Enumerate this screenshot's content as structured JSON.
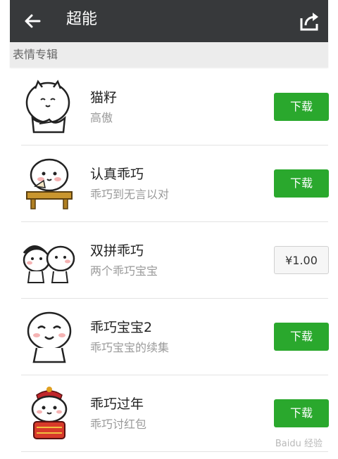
{
  "header": {
    "title": "超能",
    "back_icon": "arrow-left-icon",
    "share_icon": "share-icon"
  },
  "section": {
    "title": "表情专辑"
  },
  "items": [
    {
      "title": "猫籽",
      "subtitle": "高傲",
      "action": "下载",
      "action_type": "download",
      "sticker": "cat-sticker"
    },
    {
      "title": "认真乖巧",
      "subtitle": "乖巧到无言以对",
      "action": "下载",
      "action_type": "download",
      "sticker": "fan-desk-sticker"
    },
    {
      "title": "双拼乖巧",
      "subtitle": "两个乖巧宝宝",
      "action": "¥1.00",
      "action_type": "price",
      "sticker": "twins-sticker"
    },
    {
      "title": "乖巧宝宝2",
      "subtitle": "乖巧宝宝的续集",
      "action": "下载",
      "action_type": "download",
      "sticker": "smiling-baby-sticker"
    },
    {
      "title": "乖巧过年",
      "subtitle": "乖巧讨红包",
      "action": "下载",
      "action_type": "download",
      "sticker": "new-year-sticker"
    }
  ],
  "colors": {
    "topbar": "#37393b",
    "accent_green": "#2aa82d",
    "section_bg": "#ececec"
  },
  "watermark": "Baidu 经验"
}
